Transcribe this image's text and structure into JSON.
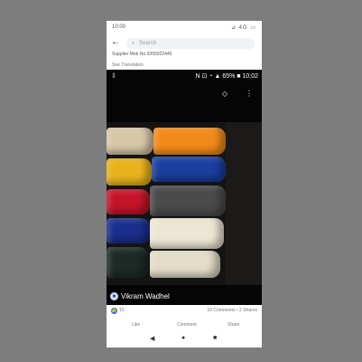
{
  "status": {
    "time": "10:00",
    "icons": "⊿ 4G ▭"
  },
  "search": {
    "back_icon": "←",
    "search_icon": "⌕",
    "placeholder": "Search"
  },
  "post": {
    "text": "Supplier Mob No 9355022445",
    "see_translation": "See Translation"
  },
  "photo_status": {
    "download_icon": "⇩",
    "right": "N ⊡ ◔ ▲ 65% ■ 10:02"
  },
  "photo_icons": {
    "tag": "◇",
    "more": "⋮"
  },
  "uploader": {
    "name": "Vikram Wadhel",
    "avatar": "●"
  },
  "reactions": {
    "like_icon": "👍",
    "count": "10",
    "comments_shares": "10 Comments • 2 Shares"
  },
  "actions": {
    "like": "Like",
    "comment": "Comment",
    "share": "Share"
  },
  "nav": {
    "back": "◀",
    "home": "●",
    "recents": "■"
  }
}
